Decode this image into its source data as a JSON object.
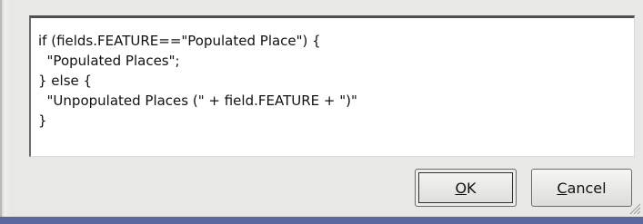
{
  "editor": {
    "lines": [
      "if (fields.FEATURE==\"Populated Place\") {",
      "  \"Populated Places\";",
      "} else {",
      "  \"Unpopulated Places (\" + field.FEATURE + \")\"",
      "}"
    ]
  },
  "buttons": {
    "ok": {
      "mnemonic": "O",
      "rest": "K"
    },
    "cancel": {
      "mnemonic": "C",
      "rest": "ancel"
    }
  },
  "colors": {
    "dialog_bg": "#e8e8e6",
    "editor_bg": "#ffffff",
    "desktop_strip": "#5b68a0"
  }
}
